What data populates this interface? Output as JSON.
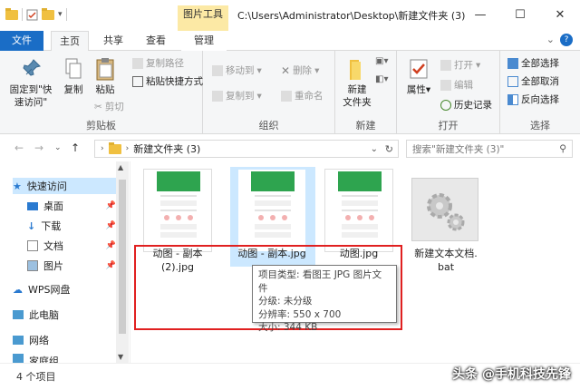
{
  "window": {
    "path": "C:\\Users\\Administrator\\Desktop\\新建文件夹 (3)",
    "tools_tab": "图片工具",
    "minimize": "—",
    "maximize": "☐",
    "close": "✕"
  },
  "tabs": {
    "file": "文件",
    "home": "主页",
    "share": "共享",
    "view": "查看",
    "manage": "管理",
    "expand": "⌄",
    "help": "?"
  },
  "ribbon": {
    "clipboard": {
      "label": "剪贴板",
      "pin": "固定到\"快速访问\"",
      "copy": "复制",
      "paste": "粘贴",
      "copy_path": "复制路径",
      "paste_shortcut": "粘贴快捷方式",
      "cut": "剪切"
    },
    "organize": {
      "label": "组织",
      "move_to": "移动到",
      "copy_to": "复制到",
      "delete": "删除",
      "rename": "重命名"
    },
    "new": {
      "label": "新建",
      "new_folder": "新建\n文件夹"
    },
    "open": {
      "label": "打开",
      "properties": "属性",
      "open": "打开",
      "edit": "编辑",
      "history": "历史记录"
    },
    "select": {
      "label": "选择",
      "select_all": "全部选择",
      "select_none": "全部取消",
      "invert": "反向选择"
    }
  },
  "address": {
    "crumb": "新建文件夹 (3)",
    "search_placeholder": "搜索\"新建文件夹 (3)\""
  },
  "nav": {
    "quick_access": "快速访问",
    "desktop": "桌面",
    "downloads": "下载",
    "documents": "文档",
    "pictures": "图片",
    "wps": "WPS网盘",
    "this_pc": "此电脑",
    "network": "网络",
    "homegroup": "家庭组"
  },
  "files": [
    {
      "name": "动图 - 副本\n(2).jpg"
    },
    {
      "name": "动图 - 副本.jpg"
    },
    {
      "name": "动图.jpg"
    },
    {
      "name": "新建文本文档.\nbat"
    }
  ],
  "tooltip": {
    "type": "项目类型: 看图王 JPG 图片文件",
    "rating": "分级: 未分级",
    "resolution": "分辨率: 550 x 700",
    "size": "大小: 344 KB"
  },
  "status": {
    "count": "4 个项目",
    "watermark": "头条 @手机科技先锋"
  }
}
